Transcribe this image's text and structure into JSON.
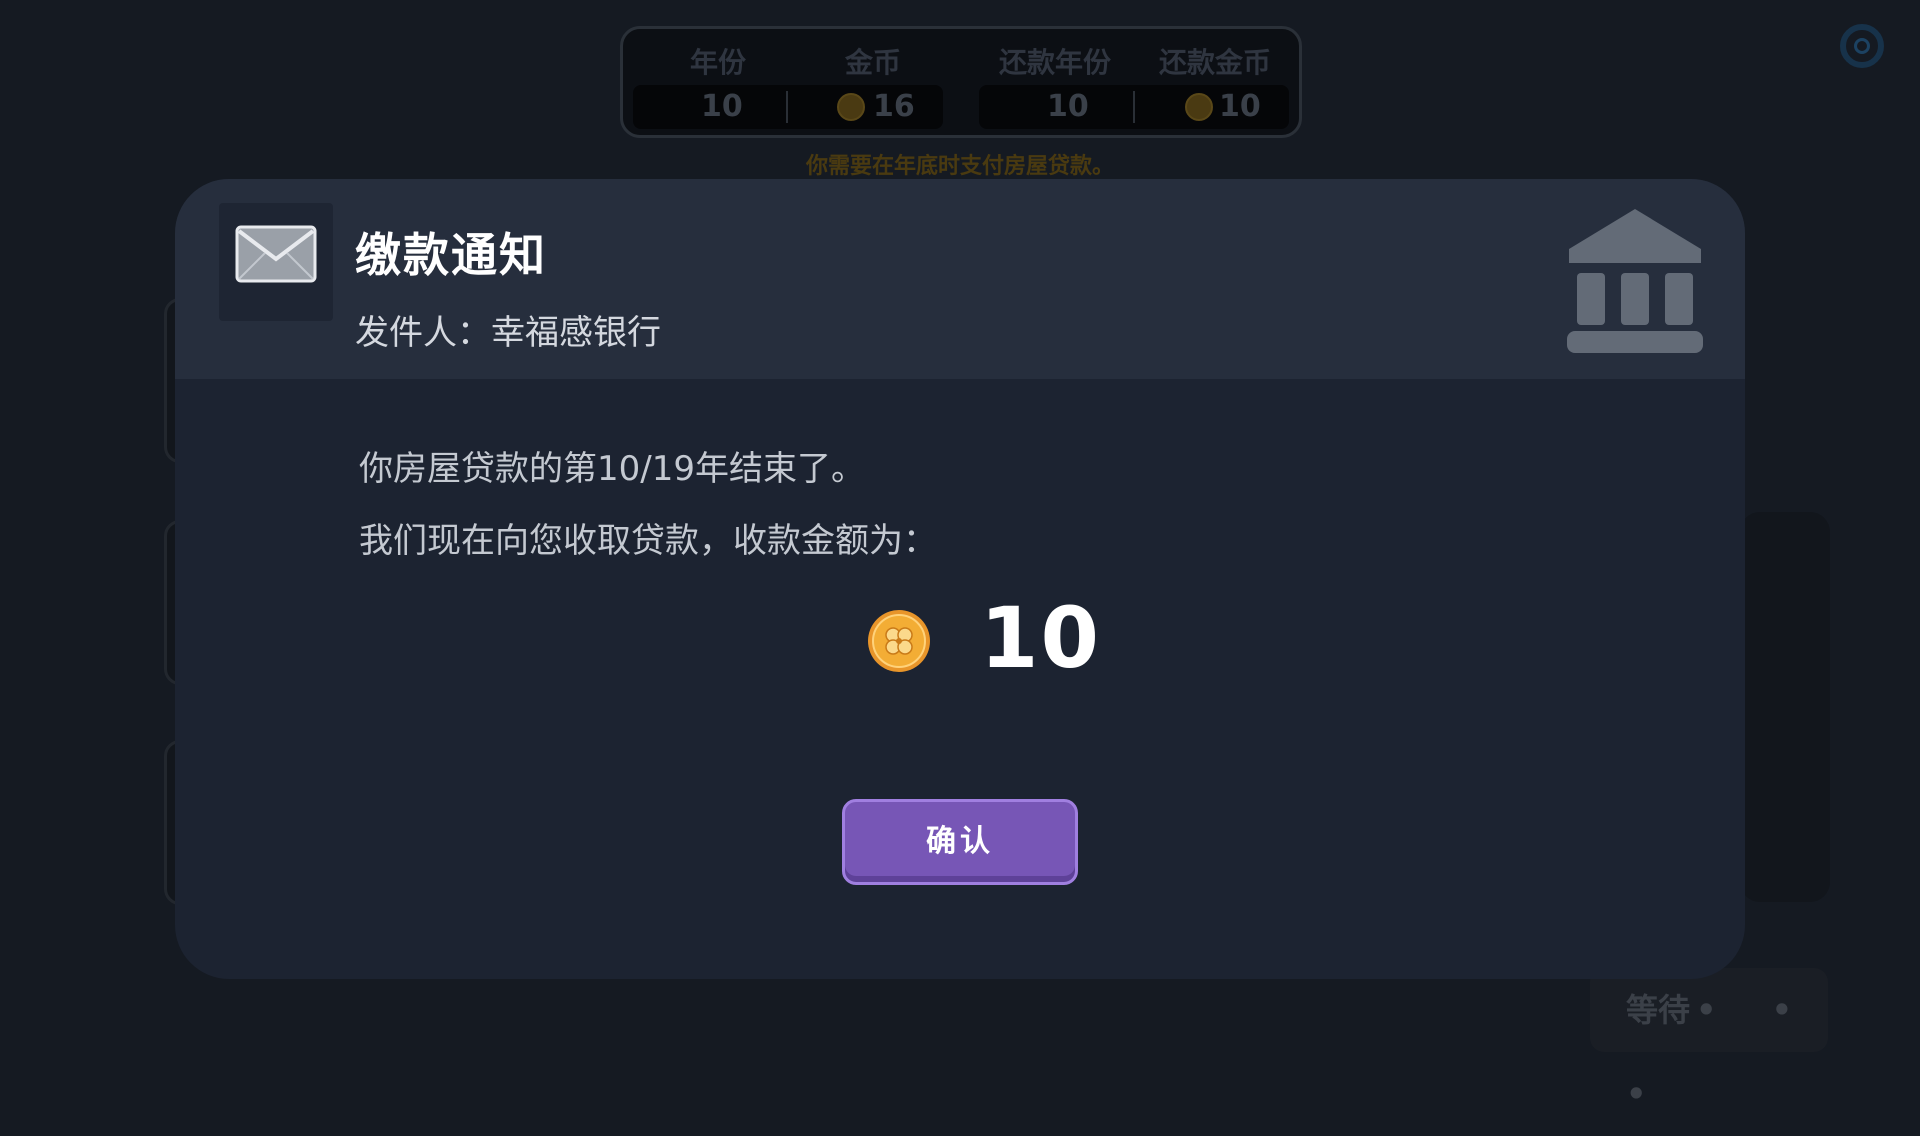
{
  "hud": {
    "headers": [
      "年份",
      "金币",
      "还款年份",
      "还款金币"
    ],
    "year": "10",
    "coins": "16",
    "repay_year": "10",
    "repay_coins": "10",
    "hint": "你需要在年底时支付房屋贷款。"
  },
  "wait_button": {
    "label": "等待",
    "dots": "• • •"
  },
  "modal": {
    "title": "缴款通知",
    "sender": "发件人：幸福感银行",
    "line1": "你房屋贷款的第10/19年结束了。",
    "line2": "我们现在向您收取贷款，收款金额为：",
    "amount": "10",
    "confirm_label": "确认"
  },
  "icons": {
    "mail": "envelope-icon",
    "bank": "bank-icon",
    "coin": "clover-coin-icon",
    "settings": "gear-icon"
  },
  "colors": {
    "modal_bg": "#1c2331",
    "header_bg": "#262e3d",
    "confirm_bg": "#7756b6",
    "coin_gold": "#f0a62a"
  }
}
